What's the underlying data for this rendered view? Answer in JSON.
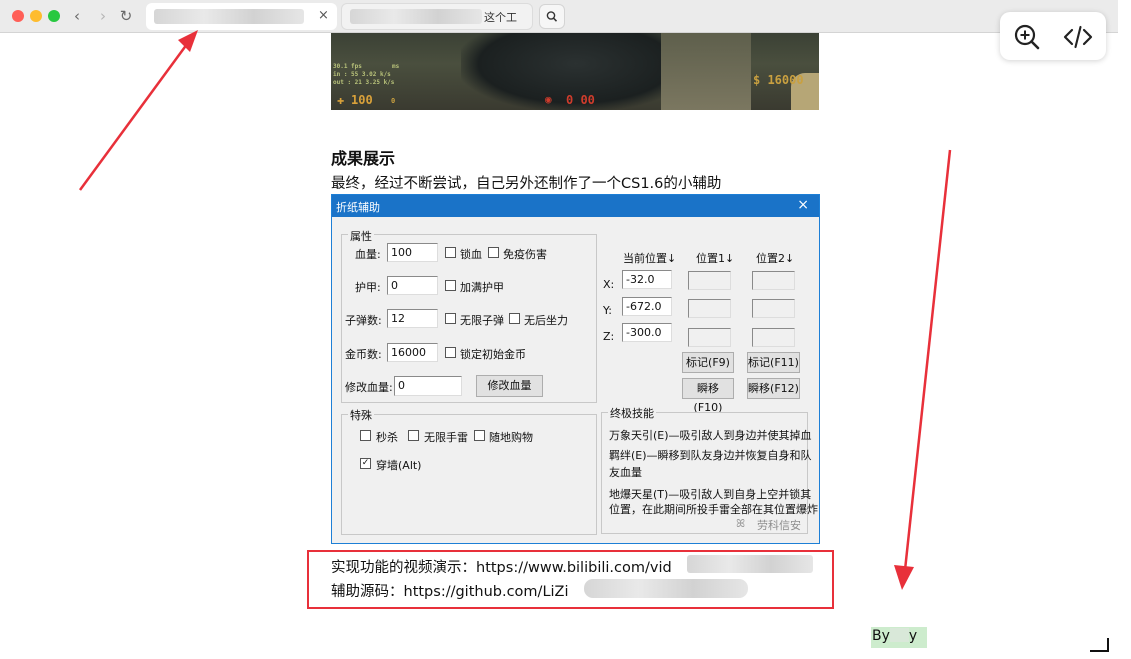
{
  "browser": {
    "tab_partial_text": "这个工",
    "nav_back": "‹",
    "nav_forward": "›",
    "reload": "↻",
    "tab_close": "×"
  },
  "game_hud": {
    "fps": "30.1 fps",
    "ms": "ms",
    "stat1": "in : 55 3.02 k/s",
    "stat2": "out : 21 3.25 k/s",
    "health": "100",
    "armor": "0",
    "ammo": "0 00",
    "money": "$ 16000"
  },
  "article": {
    "section_title": "成果展示",
    "intro": "最终，经过不断尝试，自己另外还制作了一个CS1.6的小辅助",
    "video_line": "实现功能的视频演示：https://www.bilibili.com/vid",
    "source_line": "辅助源码：https://github.com/LiZi",
    "author": "By",
    "author_end": "y"
  },
  "dialog": {
    "title": "折纸辅助",
    "close": "×",
    "attributes": {
      "group_label": "属性",
      "hp_label": "血量:",
      "hp_value": "100",
      "lock_hp": "锁血",
      "no_damage": "免疫伤害",
      "armor_label": "护甲:",
      "armor_value": "0",
      "add_armor": "加满护甲",
      "ammo_label": "子弹数:",
      "ammo_value": "12",
      "unlimited_ammo": "无限子弹",
      "no_recoil": "无后坐力",
      "money_label": "金币数:",
      "money_value": "16000",
      "lock_money": "锁定初始金币",
      "edit_hp_label": "修改血量:",
      "edit_hp_value": "0",
      "edit_hp_button": "修改血量"
    },
    "position": {
      "current": "当前位置↓",
      "pos1": "位置1↓",
      "pos2": "位置2↓",
      "x_label": "X:",
      "y_label": "Y:",
      "z_label": "Z:",
      "x_value": "-32.0",
      "y_value": "-672.0",
      "z_value": "-300.0",
      "mark_f9": "标记(F9)",
      "mark_f11": "标记(F11)",
      "tp_f10": "瞬移(F10)",
      "tp_f12": "瞬移(F12)"
    },
    "special": {
      "group_label": "特殊",
      "instant_kill": "秒杀",
      "unlimited_grenade": "无限手雷",
      "buy_anywhere": "随地购物",
      "wallhack": "穿墙(Alt)",
      "wallhack_checked": true
    },
    "ultimate": {
      "group_label": "终极技能",
      "line1": "万象天引(E)—吸引敌人到身边并使其掉血",
      "line2": "羁绊(E)—瞬移到队友身边并恢复自身和队",
      "line3": "友血量",
      "line4": "地爆天星(T)—吸引敌人到自身上空并锁其",
      "line5": "位置，在此期间所投手雷全部在其位置爆炸",
      "watermark": "劳科信安"
    }
  },
  "colors": {
    "dialog_titlebar": "#1a73c8",
    "annotation_red": "#e8303a"
  }
}
